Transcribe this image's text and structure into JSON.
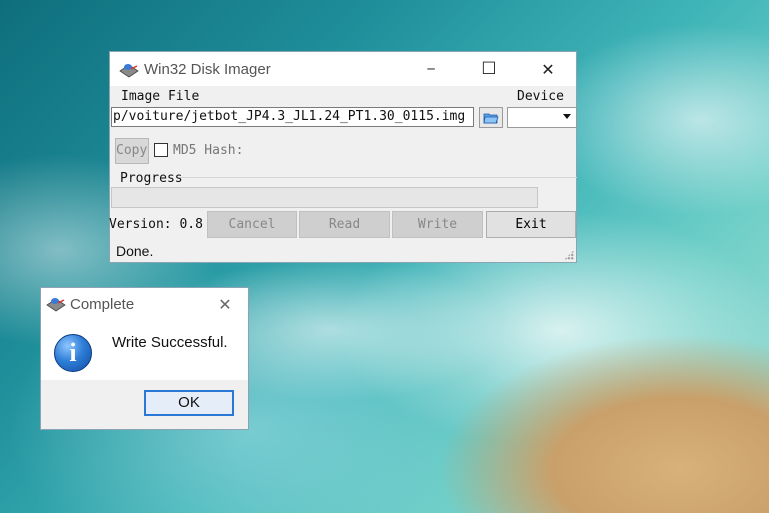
{
  "main_window": {
    "title": "Win32 Disk Imager",
    "controls": {
      "minimize": "─",
      "maximize": "☐",
      "close": "✕"
    },
    "image_file_label": "Image File",
    "image_file_value": "p/voiture/jetbot_JP4.3_JL1.24_PT1.30_0115.img",
    "device_label": "Device",
    "device_value": "",
    "copy_label": "Copy",
    "md5_label": "MD5 Hash:",
    "progress_label": "Progress",
    "progress_value": 0,
    "version_label": "Version: 0.8",
    "buttons": {
      "cancel": "Cancel",
      "read": "Read",
      "write": "Write",
      "exit": "Exit"
    },
    "status": "Done."
  },
  "dialog": {
    "title": "Complete",
    "close": "✕",
    "message": "Write Successful.",
    "ok_label": "OK"
  },
  "icons": {
    "app": "disk-imager-icon",
    "folder": "folder-open-icon",
    "info": "information-icon"
  },
  "colors": {
    "accent": "#2b78d6",
    "window_bg": "#f0f0f0",
    "disabled_text": "#888888"
  }
}
